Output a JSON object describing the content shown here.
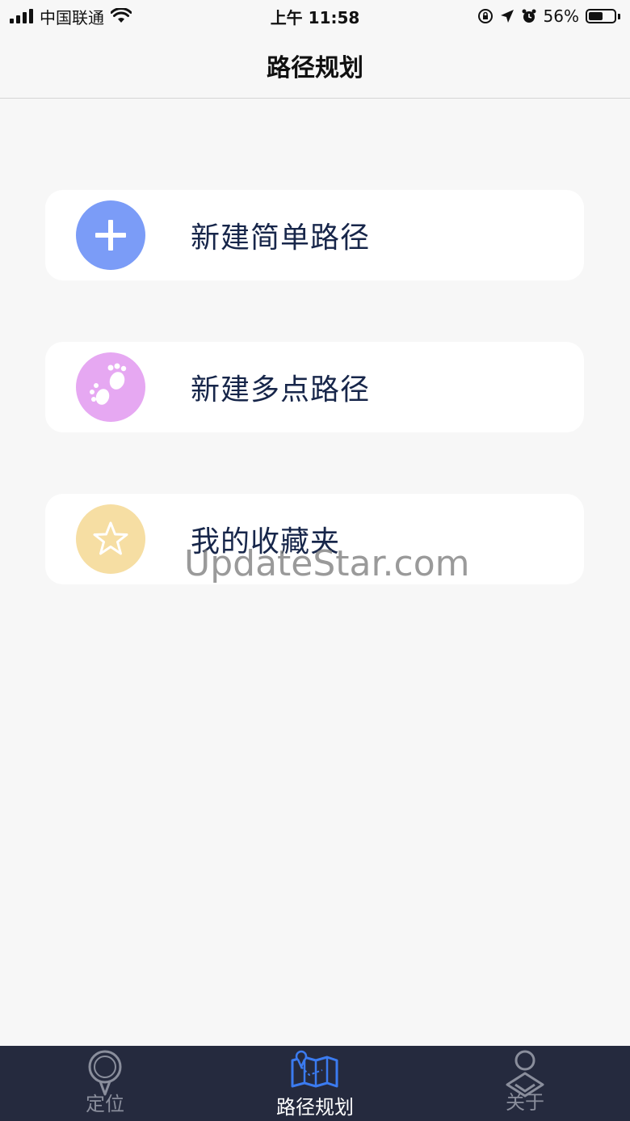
{
  "status_bar": {
    "carrier": "中国联通",
    "time": "上午 11:58",
    "battery_percent": "56%",
    "battery_level": 0.56
  },
  "nav": {
    "title": "路径规划"
  },
  "menu": {
    "items": [
      {
        "label": "新建简单路径",
        "icon": "plus-icon",
        "color": "#7b9cf7"
      },
      {
        "label": "新建多点路径",
        "icon": "footprints-icon",
        "color": "#e6a8f2"
      },
      {
        "label": "我的收藏夹",
        "icon": "star-icon",
        "color": "#f6dea3"
      }
    ]
  },
  "watermark": "UpdateStar.com",
  "tab_bar": {
    "tabs": [
      {
        "label": "定位",
        "icon": "location-pin-icon",
        "active": false
      },
      {
        "label": "路径规划",
        "icon": "map-route-icon",
        "active": true
      },
      {
        "label": "关于",
        "icon": "user-icon",
        "active": false
      }
    ]
  }
}
